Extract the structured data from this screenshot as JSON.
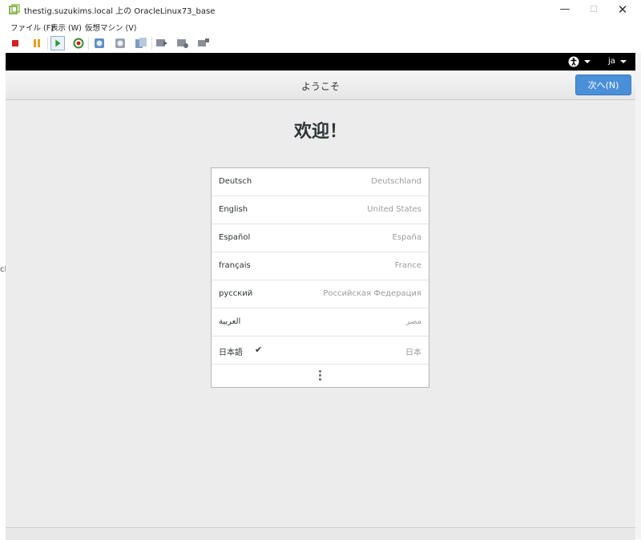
{
  "window": {
    "title": "thestig.suzukims.local 上の OracleLinux73_base",
    "minimize": "—",
    "maximize": "☐",
    "close": "✕"
  },
  "menu": {
    "file": "ファイル (F)",
    "view": "表示 (W)",
    "vm": "仮想マシン (V)"
  },
  "toolbar_icons": [
    "stop-icon",
    "pause-icon",
    "play-icon",
    "reset-icon",
    "snapshot-icon",
    "revert-snapshot-icon",
    "manage-snapshot-icon",
    "console-icon",
    "settings-icon",
    "send-keys-icon"
  ],
  "edge_text": "cl",
  "guest": {
    "top_bar": {
      "language": "ja"
    },
    "header": {
      "title": "ようこそ",
      "next_label": "次へ(N)"
    },
    "welcome_heading": "欢迎！",
    "languages": [
      {
        "name": "Deutsch",
        "region": "Deutschland"
      },
      {
        "name": "English",
        "region": "United States"
      },
      {
        "name": "Español",
        "region": "España"
      },
      {
        "name": "français",
        "region": "France"
      },
      {
        "name": "русский",
        "region": "Российская Федерация"
      },
      {
        "name": "العربية",
        "region": "مصر"
      },
      {
        "name": "日本語",
        "region": "日本",
        "selected_mark": "✔"
      }
    ]
  },
  "colors": {
    "accent": "#4a90d9",
    "guest_background": "#ececec",
    "top_bar": "#000000"
  }
}
